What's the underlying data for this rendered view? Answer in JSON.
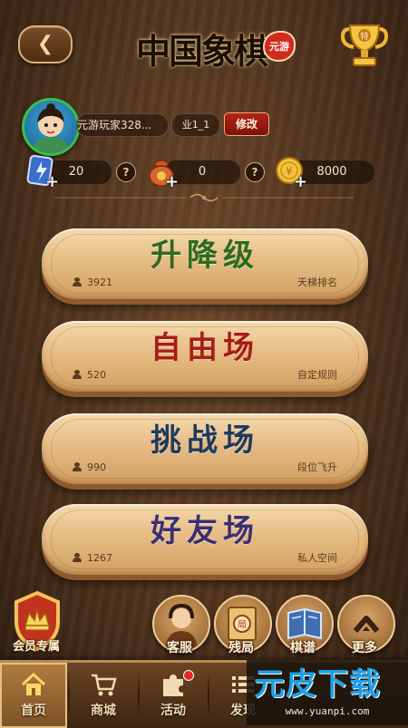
{
  "header": {
    "back_icon": "back-arrow-icon",
    "logo_text": "中国象棋",
    "logo_seal": "元游",
    "trophy_icon": "trophy-icon"
  },
  "profile": {
    "name": "元游玩家328...",
    "rank": "业1_1",
    "edit_label": "修改"
  },
  "currencies": [
    {
      "icon": "card-icon",
      "value": "20",
      "help": "?"
    },
    {
      "icon": "bag-icon",
      "value": "0",
      "help": "?"
    },
    {
      "icon": "gold-coin-icon",
      "value": "8000"
    }
  ],
  "modes": [
    {
      "title": "升降级",
      "count": "3921",
      "sub": "天梯排名",
      "color": "#2e6a1f"
    },
    {
      "title": "自由场",
      "count": "520",
      "sub": "自定规则",
      "color": "#a61e16"
    },
    {
      "title": "挑战场",
      "count": "990",
      "sub": "段位飞升",
      "color": "#203a5c"
    },
    {
      "title": "好友场",
      "count": "1267",
      "sub": "私人空间",
      "color": "#3b2f72"
    }
  ],
  "features": {
    "vip_label": "会员专属",
    "items": [
      {
        "label": "客服",
        "icon": "customer-service-icon"
      },
      {
        "label": "残局",
        "icon": "endgame-icon"
      },
      {
        "label": "棋谱",
        "icon": "chess-manual-icon"
      },
      {
        "label": "更多",
        "icon": "more-icon"
      }
    ]
  },
  "nav": {
    "items": [
      {
        "label": "首页",
        "icon": "home-icon",
        "active": true
      },
      {
        "label": "商城",
        "icon": "cart-icon"
      },
      {
        "label": "活动",
        "icon": "puzzle-icon",
        "badge": true
      },
      {
        "label": "发现",
        "icon": "list-icon"
      }
    ]
  },
  "watermark": {
    "logo": "元皮下载",
    "url": "www.yuanpi.com"
  },
  "colors": {
    "accent": "#d22b1e",
    "button_face": "#e6bc84",
    "nav_bg": "#3e2612"
  }
}
